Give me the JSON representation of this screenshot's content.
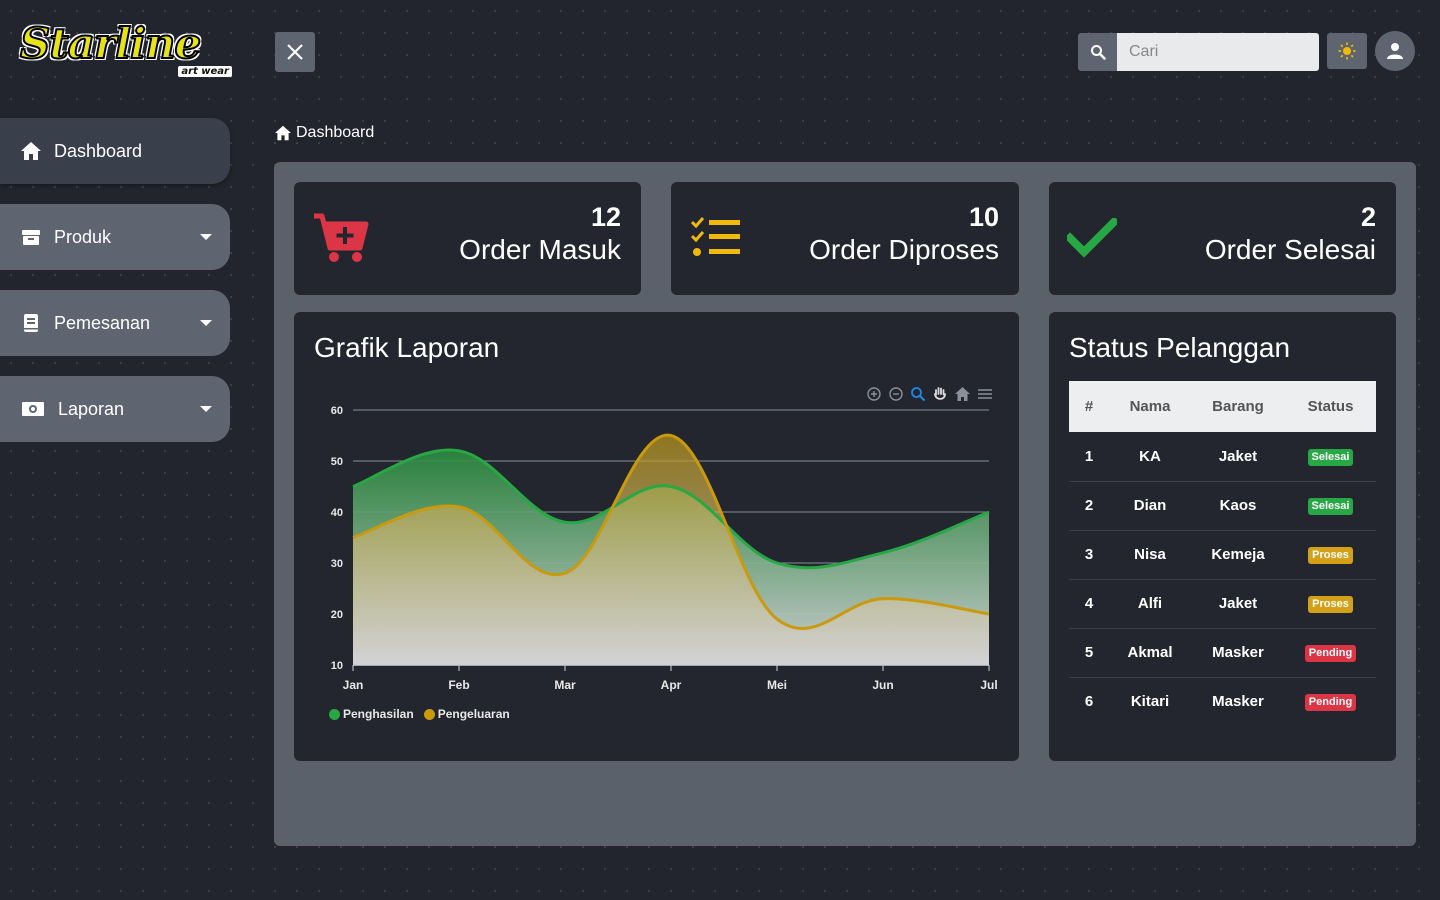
{
  "brand": {
    "logo_text": "Starline",
    "logo_sub": "art wear"
  },
  "sidebar": {
    "items": [
      {
        "label": "Dashboard",
        "icon": "home-icon",
        "active": true
      },
      {
        "label": "Produk",
        "icon": "box-icon",
        "active": false
      },
      {
        "label": "Pemesanan",
        "icon": "book-icon",
        "active": false
      },
      {
        "label": "Laporan",
        "icon": "money-icon",
        "active": false
      }
    ]
  },
  "header": {
    "search_placeholder": "Cari"
  },
  "breadcrumb": {
    "label": "Dashboard"
  },
  "stats": [
    {
      "value": "12",
      "label": "Order Masuk",
      "icon": "cart-plus-icon",
      "color": "#dc3545"
    },
    {
      "value": "10",
      "label": "Order Diproses",
      "icon": "tasks-icon",
      "color": "#f0b90b"
    },
    {
      "value": "2",
      "label": "Order Selesai",
      "icon": "check-icon",
      "color": "#28a745"
    }
  ],
  "report": {
    "title": "Grafik Laporan",
    "chart_data": {
      "type": "area",
      "categories": [
        "Jan",
        "Feb",
        "Mar",
        "Apr",
        "Mei",
        "Jun",
        "Jul"
      ],
      "series": [
        {
          "name": "Penghasilan",
          "values": [
            45,
            52,
            38,
            45,
            30,
            32,
            40
          ],
          "color": "#28a745"
        },
        {
          "name": "Pengeluaran",
          "values": [
            35,
            41,
            28,
            55,
            19,
            23,
            20
          ],
          "color": "#c99a0d"
        }
      ],
      "y_ticks": [
        10,
        20,
        30,
        40,
        50,
        60
      ],
      "ylim": [
        10,
        60
      ],
      "grid": true,
      "legend_position": "bottom-left"
    }
  },
  "customers": {
    "title": "Status Pelanggan",
    "headers": [
      "#",
      "Nama",
      "Barang",
      "Status"
    ],
    "rows": [
      {
        "no": "1",
        "nama": "KA",
        "barang": "Jaket",
        "status": "Selesai",
        "kind": "selesai"
      },
      {
        "no": "2",
        "nama": "Dian",
        "barang": "Kaos",
        "status": "Selesai",
        "kind": "selesai"
      },
      {
        "no": "3",
        "nama": "Nisa",
        "barang": "Kemeja",
        "status": "Proses",
        "kind": "proses"
      },
      {
        "no": "4",
        "nama": "Alfi",
        "barang": "Jaket",
        "status": "Proses",
        "kind": "proses"
      },
      {
        "no": "5",
        "nama": "Akmal",
        "barang": "Masker",
        "status": "Pending",
        "kind": "pending"
      },
      {
        "no": "6",
        "nama": "Kitari",
        "barang": "Masker",
        "status": "Pending",
        "kind": "pending"
      }
    ]
  }
}
